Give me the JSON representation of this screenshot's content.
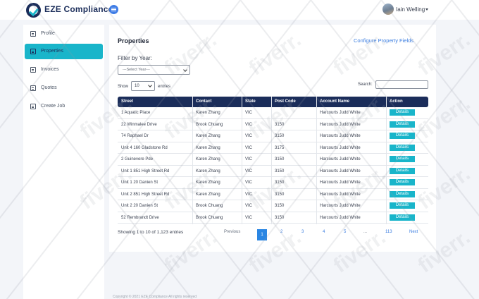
{
  "app": {
    "brand": "EZE Compliance",
    "user_name": "Iain Welling",
    "accent": "#19b5ca",
    "navy": "#1b2d5a",
    "link": "#3b7de0"
  },
  "sidebar": {
    "items": [
      {
        "label": "Profile",
        "icon": "user-card-icon",
        "active": false
      },
      {
        "label": "Properties",
        "icon": "building-icon",
        "active": true
      },
      {
        "label": "Invoices",
        "icon": "invoice-icon",
        "active": false
      },
      {
        "label": "Quotes",
        "icon": "quote-icon",
        "active": false
      },
      {
        "label": "Create Job",
        "icon": "create-job-icon",
        "active": false
      }
    ]
  },
  "main": {
    "title": "Properties",
    "config_link": "Configure Property Fields",
    "filter_label": "Filter by Year:",
    "year_select_value": "---Select Year---",
    "show_label": "Show",
    "page_length": "10",
    "entries_label": "entries",
    "search_label": "Search:",
    "columns": [
      "Street",
      "Contact",
      "State",
      "Post Code",
      "Account Name",
      "Action"
    ],
    "rows": [
      {
        "street": "1 Aquatic Place",
        "contact": "Karen Zhang",
        "state": "VIC",
        "postcode": "",
        "account": "Harcourts Judd White",
        "action": "Details"
      },
      {
        "street": "22 Winmalee Drive",
        "contact": "Brook Chuang",
        "state": "VIC",
        "postcode": "3150",
        "account": "Harcourts Judd White",
        "action": "Details"
      },
      {
        "street": "74 Raphael Dr",
        "contact": "Karen Zhang",
        "state": "VIC",
        "postcode": "3150",
        "account": "Harcourts Judd White",
        "action": "Details"
      },
      {
        "street": "Unit 4 160 Gladstone Rd",
        "contact": "Karen Zhang",
        "state": "VIC",
        "postcode": "3175",
        "account": "Harcourts Judd White",
        "action": "Details"
      },
      {
        "street": "2 Guinevere Pde",
        "contact": "Karen Zhang",
        "state": "VIC",
        "postcode": "3150",
        "account": "Harcourts Judd White",
        "action": "Details"
      },
      {
        "street": "Unit 1 851 High Street Rd",
        "contact": "Karen Zhang",
        "state": "VIC",
        "postcode": "3150",
        "account": "Harcourts Judd White",
        "action": "Details"
      },
      {
        "street": "Unit 1 20 Danien St",
        "contact": "Karen Zhang",
        "state": "VIC",
        "postcode": "3150",
        "account": "Harcourts Judd White",
        "action": "Details"
      },
      {
        "street": "Unit 2 851 High Street Rd",
        "contact": "Karen Zhang",
        "state": "VIC",
        "postcode": "3150",
        "account": "Harcourts Judd White",
        "action": "Details"
      },
      {
        "street": "Unit 2 20 Danien St",
        "contact": "Brook Chuang",
        "state": "VIC",
        "postcode": "3150",
        "account": "Harcourts Judd White",
        "action": "Details"
      },
      {
        "street": "52 Rembrandt Drive",
        "contact": "Brook Chuang",
        "state": "VIC",
        "postcode": "3150",
        "account": "Harcourts Judd White",
        "action": "Details"
      }
    ],
    "showing_text": "Showing 1 to 10 of 1,123 entries",
    "pagination": {
      "previous": "Previous",
      "pages": [
        "1",
        "2",
        "3",
        "4",
        "5",
        "...",
        "113"
      ],
      "active_page": "1",
      "next": "Next"
    }
  },
  "footer": {
    "text": "Copyright © 2021 EZE Compliance All rights reserved"
  },
  "watermark": {
    "text": "fiverr."
  }
}
